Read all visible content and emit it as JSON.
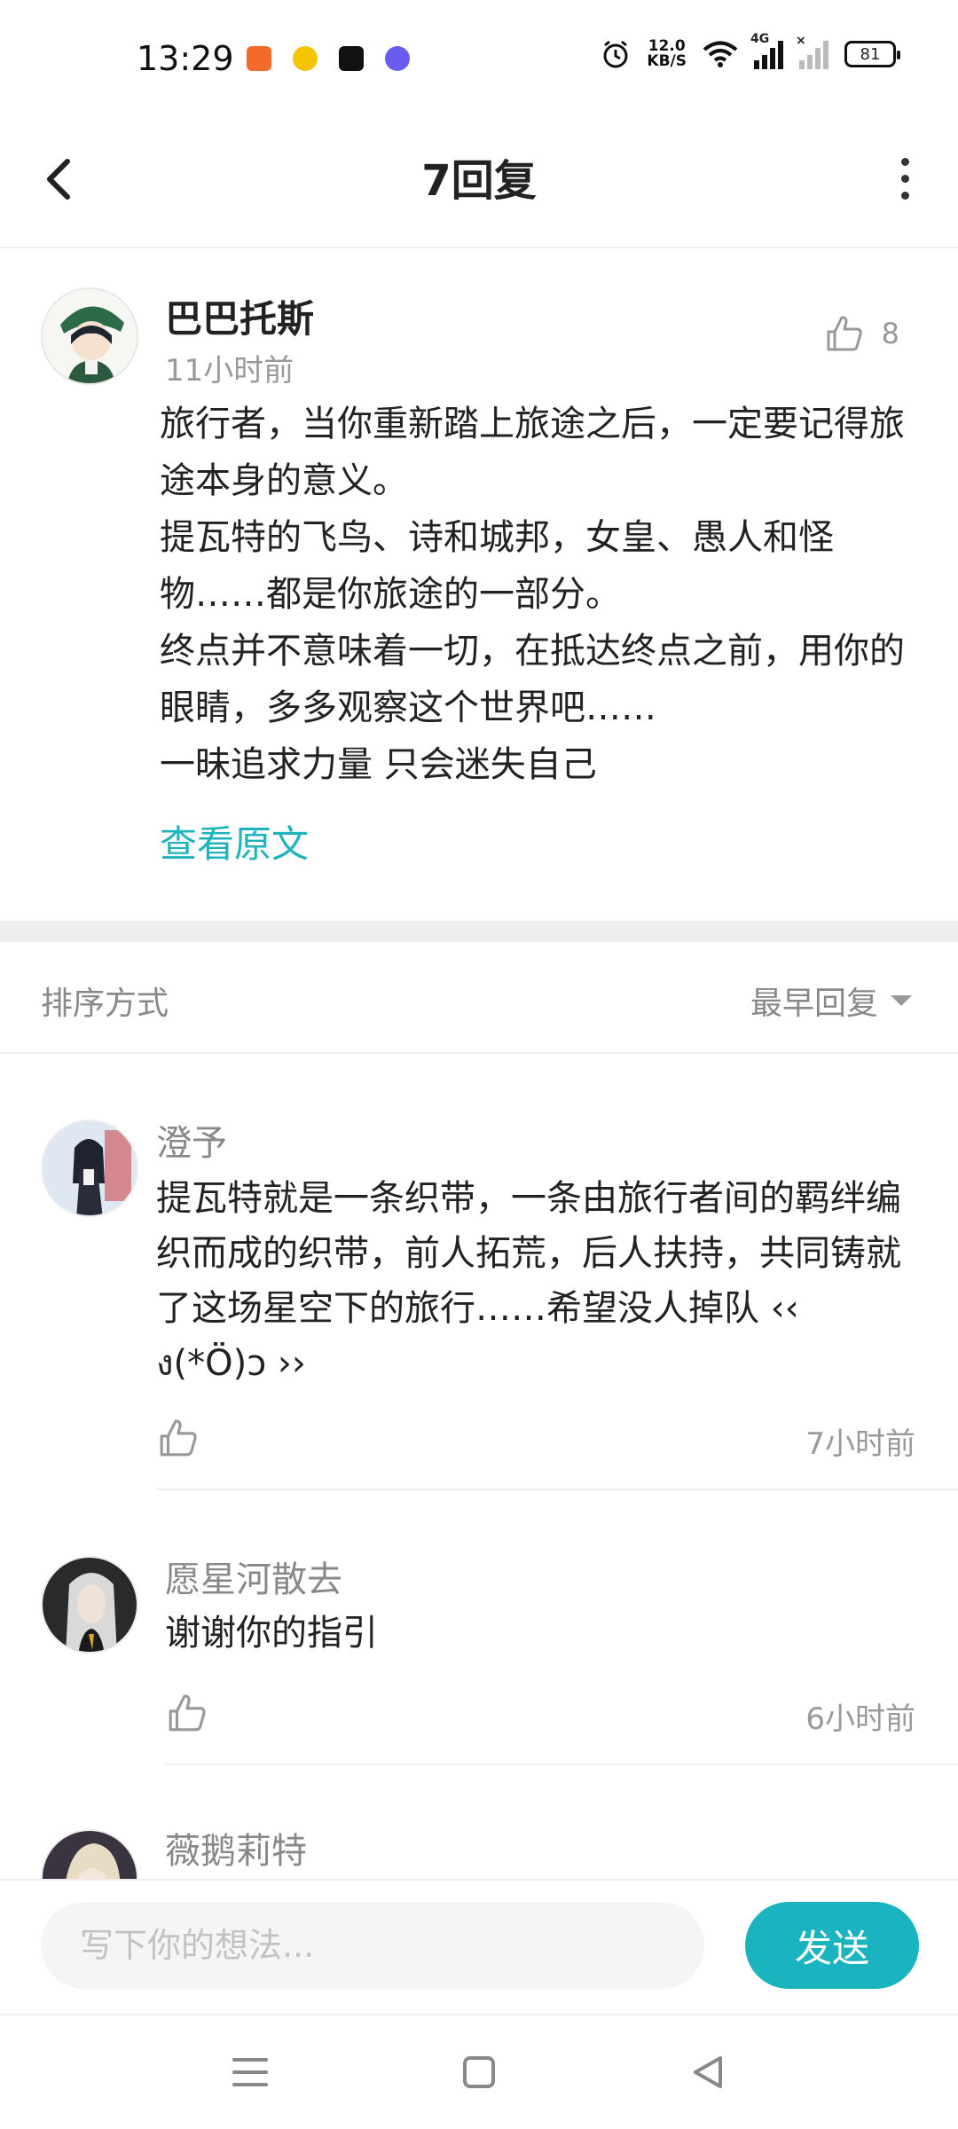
{
  "status_bar": {
    "time": "13:29",
    "net_speed_value": "12.0",
    "net_speed_unit": "KB/S",
    "network_type": "4G",
    "battery": "81"
  },
  "header": {
    "title": "7回复"
  },
  "post": {
    "author": "巴巴托斯",
    "time": "11小时前",
    "like_count": "8",
    "lines": [
      "旅行者，当你重新踏上旅途之后，一定要记得旅途本身的意义。",
      "提瓦特的飞鸟、诗和城邦，女皇、愚人和怪物……都是你旅途的一部分。",
      "终点并不意味着一切，在抵达终点之前，用你的眼睛，多多观察这个世界吧……",
      "一昧追求力量 只会迷失自己"
    ],
    "view_original": "查看原文"
  },
  "sort": {
    "label": "排序方式",
    "selected": "最早回复"
  },
  "replies": [
    {
      "author": "澄予",
      "text": "提瓦特就是一条织带，一条由旅行者间的羁绊编织而成的织带，前人拓荒，后人扶持，共同铸就了这场星空下的旅行……希望没人掉队 ‹‹ ง(*Ö)ɔ ››",
      "time": "7小时前"
    },
    {
      "author": "愿星河散去",
      "text": "谢谢你的指引",
      "time": "6小时前"
    },
    {
      "author": "薇鹅莉特",
      "text": "",
      "time": ""
    }
  ],
  "input_bar": {
    "placeholder": "写下你的想法...",
    "send_label": "发送"
  },
  "colors": {
    "accent": "#1ab3c0",
    "link": "#1fb3bd",
    "divider_band": "#eeeeee"
  }
}
